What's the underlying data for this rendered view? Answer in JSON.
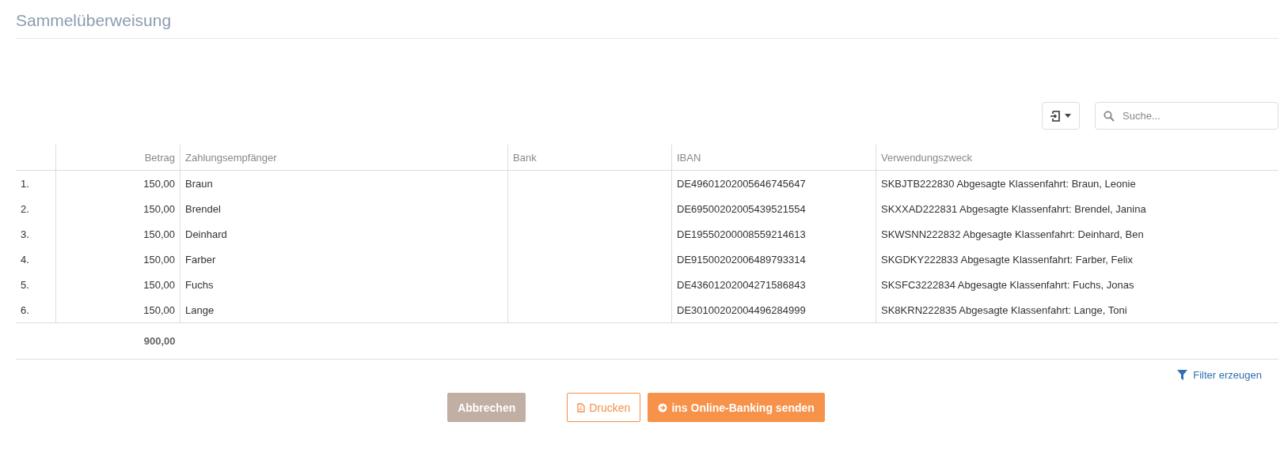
{
  "title": "Sammelüberweisung",
  "toolbar": {
    "search": {
      "placeholder": "Suche..."
    }
  },
  "table": {
    "columns": [
      "Betrag",
      "Zahlungsempfänger",
      "Bank",
      "IBAN",
      "Verwendungszweck"
    ],
    "rows": [
      {
        "number": "1.",
        "amount": "150,00",
        "recipient": "Braun",
        "iban": "DE49601202005646745647",
        "purpose": "SKBJTB222830 Abgesagte Klassenfahrt: Braun, Leonie"
      },
      {
        "number": "2.",
        "amount": "150,00",
        "recipient": "Brendel",
        "iban": "DE69500202005439521554",
        "purpose": "SKXXAD222831 Abgesagte Klassenfahrt: Brendel, Janina"
      },
      {
        "number": "3.",
        "amount": "150,00",
        "recipient": "Deinhard",
        "iban": "DE19550200008559214613",
        "purpose": "SKWSNN222832 Abgesagte Klassenfahrt: Deinhard, Ben"
      },
      {
        "number": "4.",
        "amount": "150,00",
        "recipient": "Farber",
        "iban": "DE91500202006489793314",
        "purpose": "SKGDKY222833 Abgesagte Klassenfahrt: Farber, Felix"
      },
      {
        "number": "5.",
        "amount": "150,00",
        "recipient": "Fuchs",
        "iban": "DE43601202004271586843",
        "purpose": "SKSFC3222834 Abgesagte Klassenfahrt: Fuchs, Jonas"
      },
      {
        "number": "6.",
        "amount": "150,00",
        "recipient": "Lange",
        "iban": "DE30100202004496284999",
        "purpose": "SK8KRN222835 Abgesagte Klassenfahrt: Lange, Toni"
      }
    ],
    "total": "900,00"
  },
  "filter_link": "Filter erzeugen",
  "buttons": [
    {
      "kind": "cancel",
      "label": "Abbrechen"
    },
    {
      "kind": "print",
      "label": "Drucken"
    },
    {
      "kind": "send",
      "label": "ins Online-Banking senden"
    }
  ]
}
